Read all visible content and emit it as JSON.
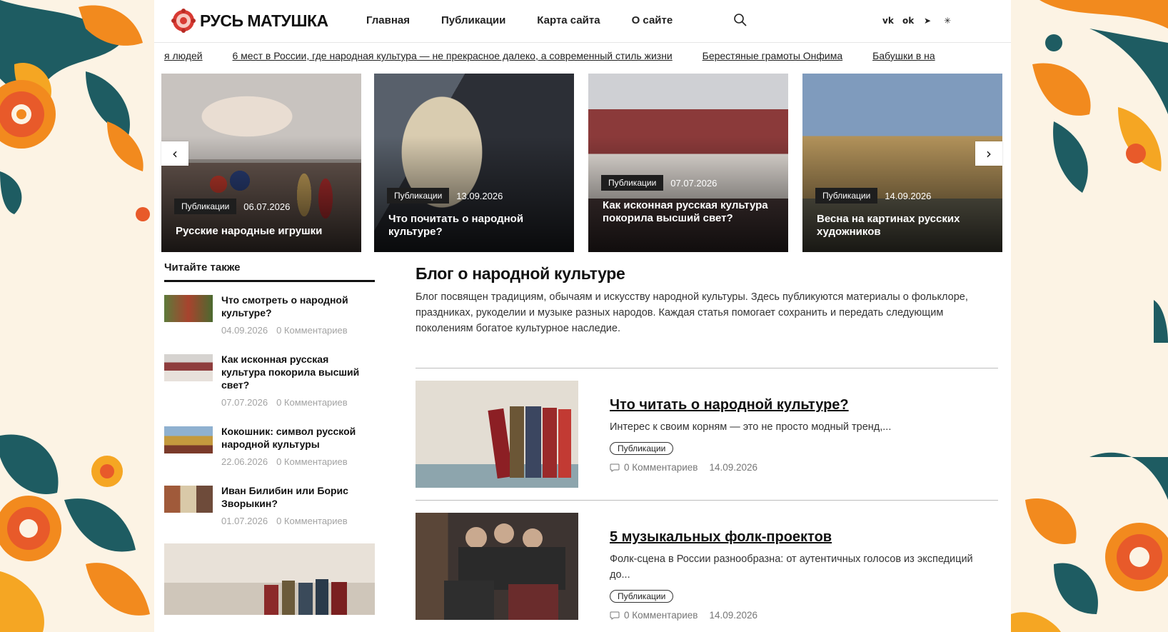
{
  "logo": {
    "text": "РУСЬ МАТУШКА"
  },
  "nav": [
    "Главная",
    "Публикации",
    "Карта сайта",
    "О сайте"
  ],
  "socials": [
    "vk-icon",
    "odnoklassniki-icon",
    "telegram-icon",
    "dzen-icon"
  ],
  "ticker": [
    "я людей",
    "6 мест в России, где народная культура — не прекрасное далеко, а современный стиль жизни",
    "Берестяные грамоты Онфима",
    "Бабушки в на"
  ],
  "slides": [
    {
      "tag": "Публикации",
      "date": "06.07.2026",
      "title": "Русские народные игрушки"
    },
    {
      "tag": "Публикации",
      "date": "13.09.2026",
      "title": "Что почитать о народной культуре?"
    },
    {
      "tag": "Публикации",
      "date": "07.07.2026",
      "title": "Как исконная русская культура покорила высший свет?"
    },
    {
      "tag": "Публикации",
      "date": "14.09.2026",
      "title": "Весна на картинах русских художников"
    }
  ],
  "sidebar": {
    "title": "Читайте также",
    "items": [
      {
        "title": "Что смотреть о народной культуре?",
        "date": "04.09.2026",
        "comments": "0 Комментариев"
      },
      {
        "title": "Как исконная русская культура покорила высший свет?",
        "date": "07.07.2026",
        "comments": "0 Комментариев"
      },
      {
        "title": "Кокошник: символ русской народной культуры",
        "date": "22.06.2026",
        "comments": "0 Комментариев"
      },
      {
        "title": "Иван Билибин или Борис Зворыкин?",
        "date": "01.07.2026",
        "comments": "0 Комментариев"
      }
    ]
  },
  "main": {
    "title": "Блог о народной культуре",
    "intro": "Блог посвящен традициям, обычаям и искусству народной культуры. Здесь публикуются материалы о фольклоре, праздниках, рукоделии и музыке разных народов. Каждая статья помогает сохранить и передать следующим поколениям богатое культурное наследие.",
    "posts": [
      {
        "title": "Что читать о народной культуре?",
        "excerpt": "Интерес к своим корням — это не просто модный тренд,...",
        "tag": "Публикации",
        "comments": "0 Комментариев",
        "date": "14.09.2026"
      },
      {
        "title": "5 музыкальных фолк-проектов",
        "excerpt": "Фолк-сцена в России разнообразна: от аутентичных голосов из экспедиций до...",
        "tag": "Публикации",
        "comments": "0 Комментариев",
        "date": "14.09.2026"
      }
    ]
  },
  "colors": {
    "accent": "#d83a33",
    "orange": "#f28a1e",
    "teal": "#1e5c62",
    "cream": "#fcf3e4"
  }
}
